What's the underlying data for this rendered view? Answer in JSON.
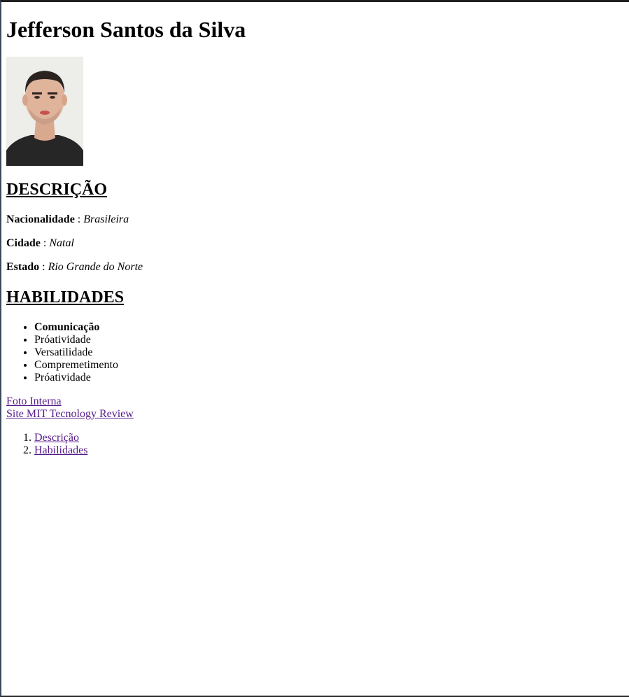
{
  "profile": {
    "name": "Jefferson Santos da Silva",
    "photo_alt": "photo"
  },
  "descricao": {
    "heading": "DESCRIÇÃO",
    "fields": [
      {
        "label": "Nacionalidade",
        "sep": ":",
        "value": "Brasileira"
      },
      {
        "label": "Cidade",
        "sep": ":",
        "value": "Natal"
      },
      {
        "label": "Estado",
        "sep": ":",
        "value": "Rio Grande do Norte"
      }
    ]
  },
  "habilidades": {
    "heading": "HABILIDADES",
    "items": [
      "Comunicação",
      "Próatividade",
      "Versatilidade",
      "Compremetimento",
      "Próatividade"
    ]
  },
  "links": {
    "foto_interna": "Foto Interna",
    "site_mit": "Site MIT Tecnology Review"
  },
  "toc": {
    "items": [
      "Descrição",
      "Habilidades"
    ]
  },
  "colors": {
    "visited_link": "#551a8b",
    "text": "#000000",
    "background": "#ffffff"
  }
}
